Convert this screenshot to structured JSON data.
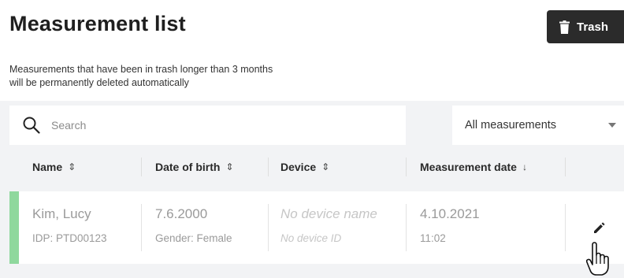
{
  "header": {
    "title": "Measurement list",
    "trash_button_label": "Trash",
    "trash_icon": "trash-icon"
  },
  "notice": {
    "line1": "Measurements that have been in trash longer than 3 months",
    "line2": "will be permanently deleted automatically"
  },
  "search": {
    "placeholder": "Search",
    "value": "",
    "icon": "search-icon"
  },
  "filter": {
    "selected": "All measurements",
    "icon": "caret-down-icon"
  },
  "table": {
    "columns": [
      {
        "label": "Name",
        "sort_icon": "⇕"
      },
      {
        "label": "Date of birth",
        "sort_icon": "⇕"
      },
      {
        "label": "Device",
        "sort_icon": "⇕"
      },
      {
        "label": "Measurement date",
        "sort_icon": "↓"
      }
    ],
    "rows": [
      {
        "name": "Kim, Lucy",
        "idp": "IDP: PTD00123",
        "dob": "7.6.2000",
        "gender": "Gender: Female",
        "device_name": "No device name",
        "device_id": "No device ID",
        "measurement_date": "4.10.2021",
        "measurement_time": "11:02",
        "status_color": "#8fd89d",
        "action_icon": "pencil-icon"
      }
    ]
  },
  "colors": {
    "accent_dark": "#2b2b2b",
    "row_status": "#8fd89d",
    "background": "#f2f3f5"
  }
}
